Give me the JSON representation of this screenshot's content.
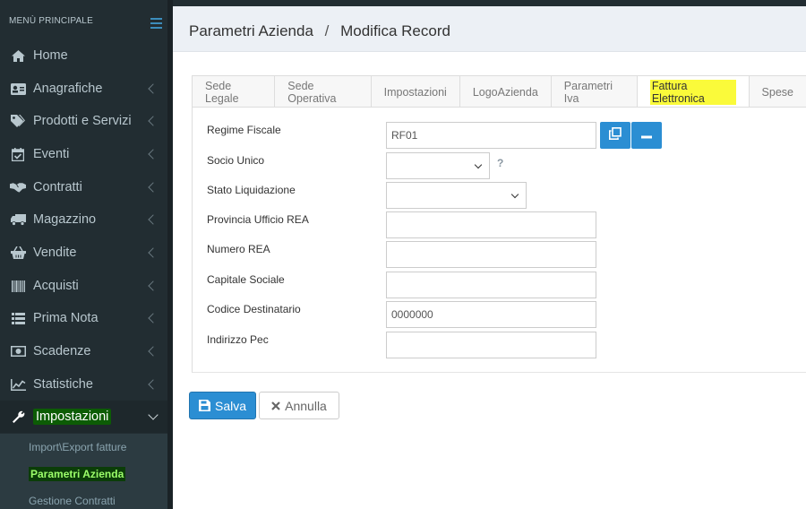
{
  "sidebar": {
    "header": "MENÙ PRINCIPALE",
    "items": [
      {
        "label": "Home",
        "icon": "home-icon"
      },
      {
        "label": "Anagrafiche",
        "icon": "id-card-icon"
      },
      {
        "label": "Prodotti e Servizi",
        "icon": "tags-icon"
      },
      {
        "label": "Eventi",
        "icon": "calendar-check-icon"
      },
      {
        "label": "Contratti",
        "icon": "handshake-icon"
      },
      {
        "label": "Magazzino",
        "icon": "truck-icon"
      },
      {
        "label": "Vendite",
        "icon": "basket-icon"
      },
      {
        "label": "Acquisti",
        "icon": "barcode-icon"
      },
      {
        "label": "Prima Nota",
        "icon": "list-icon"
      },
      {
        "label": "Scadenze",
        "icon": "money-icon"
      },
      {
        "label": "Statistiche",
        "icon": "line-chart-icon"
      },
      {
        "label": "Impostazioni",
        "icon": "wrench-icon"
      }
    ],
    "subitems": [
      {
        "label": "Import\\Export fatture"
      },
      {
        "label": "Parametri Azienda"
      },
      {
        "label": "Gestione Contratti"
      }
    ]
  },
  "header": {
    "section": "Parametri Azienda",
    "separator": "/",
    "page": "Modifica Record"
  },
  "tabs": [
    {
      "label": "Sede Legale"
    },
    {
      "label": "Sede Operativa"
    },
    {
      "label": "Impostazioni"
    },
    {
      "label": "LogoAzienda"
    },
    {
      "label": "Parametri Iva"
    },
    {
      "label": "Fattura Elettronica"
    },
    {
      "label": "Spese"
    }
  ],
  "form": {
    "regime_fiscale": {
      "label": "Regime Fiscale",
      "value": "RF01"
    },
    "socio_unico": {
      "label": "Socio Unico",
      "value": "",
      "help": "?"
    },
    "stato_liquidazione": {
      "label": "Stato Liquidazione",
      "value": ""
    },
    "provincia_rea": {
      "label": "Provincia Ufficio REA",
      "value": ""
    },
    "numero_rea": {
      "label": "Numero REA",
      "value": ""
    },
    "capitale_sociale": {
      "label": "Capitale Sociale",
      "value": ""
    },
    "codice_destinatario": {
      "label": "Codice Destinatario",
      "value": "0000000"
    },
    "indirizzo_pec": {
      "label": "Indirizzo Pec",
      "value": ""
    }
  },
  "actions": {
    "save_label": "Salva",
    "cancel_label": "Annulla"
  },
  "colors": {
    "sidebar_bg": "#222d32",
    "primary": "#2b8ed3",
    "highlight_tab": "#fafa3a",
    "highlight_green": "#0c5c05"
  }
}
